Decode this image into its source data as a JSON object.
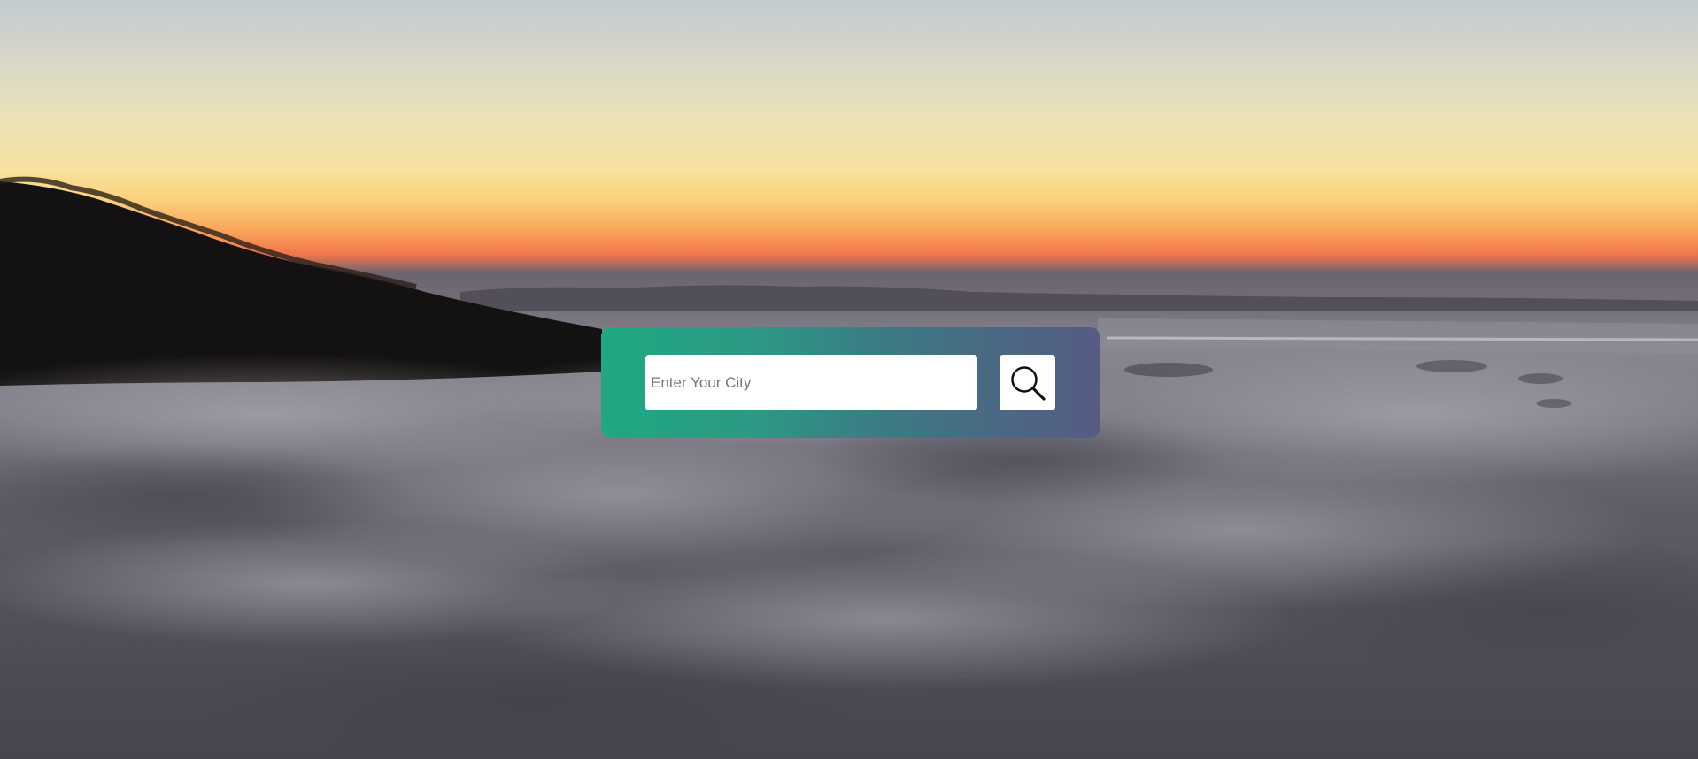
{
  "search": {
    "placeholder": "Enter Your City",
    "value": "",
    "button_icon": "search-icon"
  },
  "colors": {
    "panel_gradient_start": "#1fa883",
    "panel_gradient_end": "#575b85",
    "input_background": "#ffffff",
    "button_background": "#ffffff"
  }
}
